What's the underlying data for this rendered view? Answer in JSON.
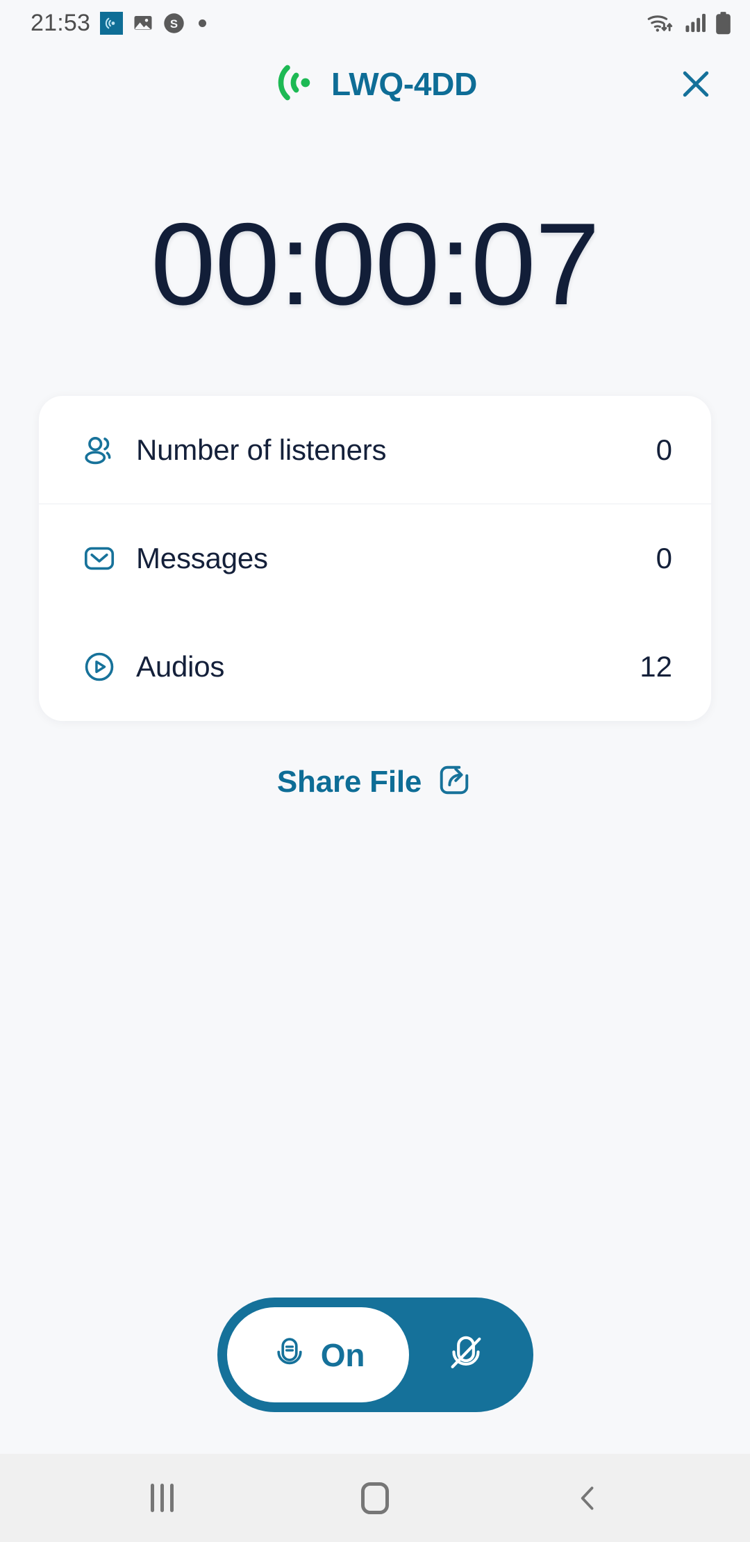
{
  "status_bar": {
    "clock": "21:53",
    "notification_icons": [
      "broadcast-app-icon",
      "image-icon",
      "skype-icon",
      "more-dot-icon"
    ],
    "system_icons": [
      "wifi-data-icon",
      "cellular-signal-icon",
      "battery-icon"
    ]
  },
  "header": {
    "broadcast_icon": "broadcast-signal-icon",
    "title": "LWQ-4DD",
    "close_icon": "close-icon"
  },
  "timer": {
    "value": "00:00:07"
  },
  "stats": [
    {
      "icon": "people-icon",
      "label": "Number of listeners",
      "value": "0"
    },
    {
      "icon": "envelope-icon",
      "label": "Messages",
      "value": "0"
    },
    {
      "icon": "play-circle-icon",
      "label": "Audios",
      "value": "12"
    }
  ],
  "share": {
    "label": "Share File",
    "icon": "share-export-icon"
  },
  "mic_toggle": {
    "on_label": "On",
    "on_icon": "microphone-icon",
    "off_icon": "microphone-muted-icon",
    "state": "on"
  },
  "nav_bar": {
    "recents_label": "recents-icon",
    "home_label": "home-icon",
    "back_label": "back-icon"
  },
  "colors": {
    "accent_teal": "#0e6d96",
    "toggle_teal": "#15719a",
    "broadcast_green": "#1db954",
    "text_navy": "#14203a",
    "page_bg": "#f7f8fa",
    "card_bg": "#ffffff",
    "navbar_bg": "#f0f0f0"
  }
}
